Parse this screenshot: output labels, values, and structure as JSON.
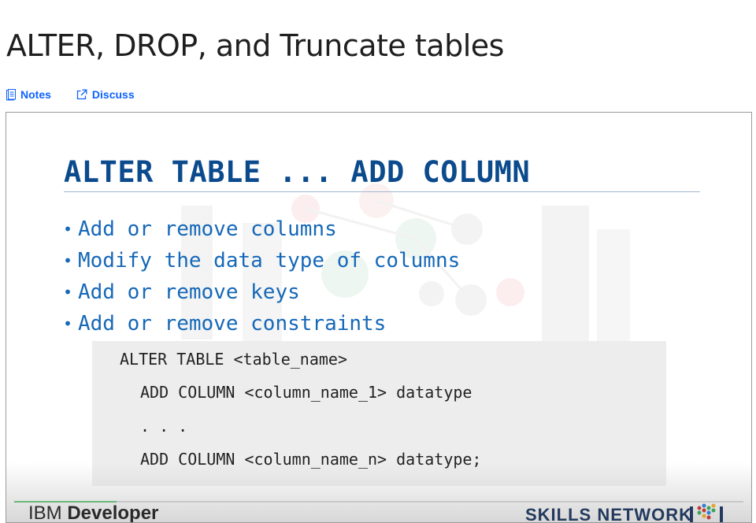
{
  "page": {
    "title": "ALTER, DROP, and Truncate tables"
  },
  "actions": {
    "notes": {
      "label": "Notes",
      "icon": "notes-icon"
    },
    "discuss": {
      "label": "Discuss",
      "icon": "external-link-icon"
    }
  },
  "video": {
    "slide": {
      "title": "ALTER TABLE ... ADD COLUMN",
      "bullets": [
        "Add or remove columns",
        "Modify the data type of columns",
        "Add or remove keys",
        "Add or remove constraints"
      ],
      "code": [
        "ALTER TABLE <table_name>",
        "ADD COLUMN <column_name_1> datatype",
        ". . .",
        "ADD COLUMN <column_name_n> datatype;"
      ]
    },
    "footer": {
      "ibm_light": "IBM ",
      "ibm_bold": "Developer",
      "skills_network": "SKILLS NETWORK"
    },
    "progress_fraction": 0.14
  },
  "colors": {
    "link": "#0f62fe",
    "slide_title": "#0b4a8c",
    "slide_bullets": "#1668b8",
    "progress": "#6ab87a"
  }
}
